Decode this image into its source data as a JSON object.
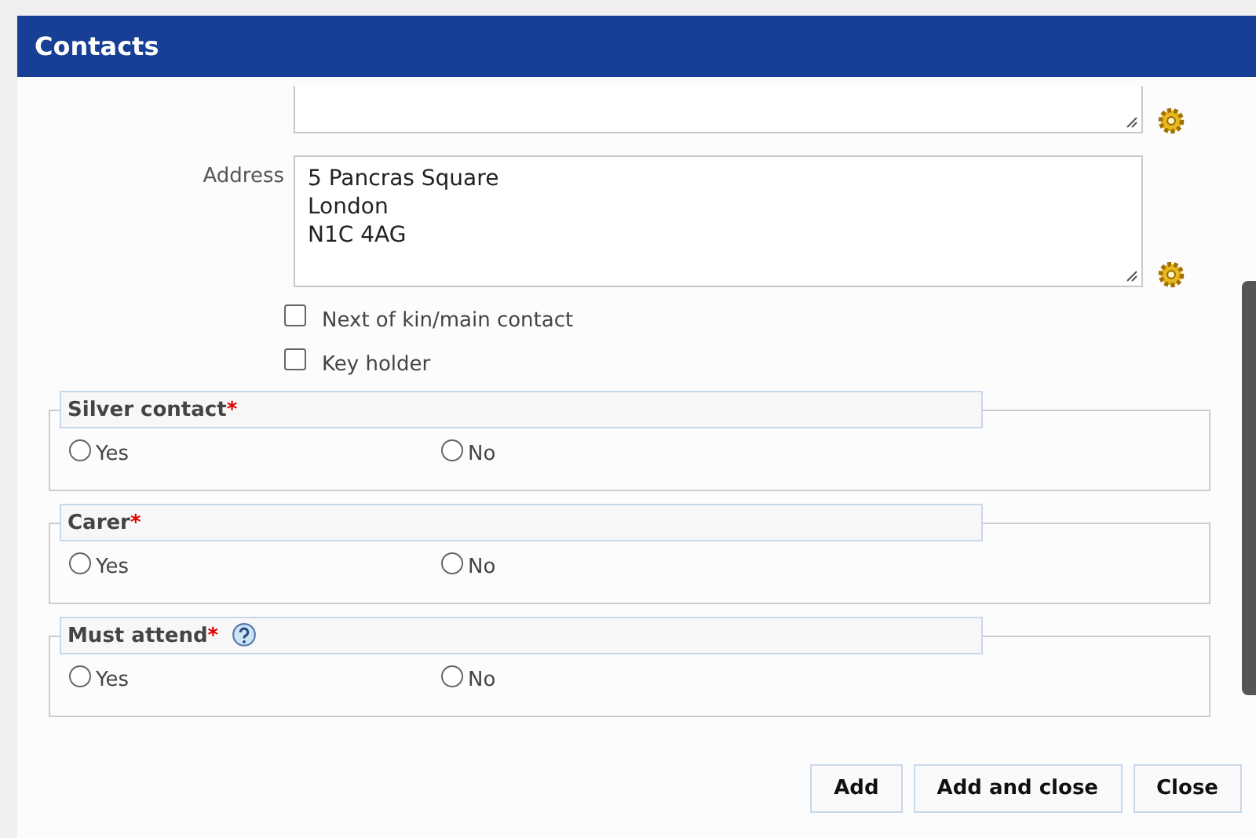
{
  "window": {
    "title": "Contacts"
  },
  "address": {
    "label": "Address",
    "value": "5 Pancras Square\nLondon\nN1C 4AG"
  },
  "checkboxes": [
    {
      "label": "Next of kin/main contact",
      "checked": false
    },
    {
      "label": "Key holder",
      "checked": false
    }
  ],
  "groups": [
    {
      "legend": "Silver contact",
      "required_mark": "*",
      "help": false,
      "options": [
        {
          "label": "Yes",
          "selected": false
        },
        {
          "label": "No",
          "selected": false
        }
      ]
    },
    {
      "legend": "Carer",
      "required_mark": "*",
      "help": false,
      "options": [
        {
          "label": "Yes",
          "selected": false
        },
        {
          "label": "No",
          "selected": false
        }
      ]
    },
    {
      "legend": "Must attend",
      "required_mark": "*",
      "help": true,
      "options": [
        {
          "label": "Yes",
          "selected": false
        },
        {
          "label": "No",
          "selected": false
        }
      ]
    }
  ],
  "buttons": [
    "Add",
    "Add and close",
    "Close"
  ]
}
